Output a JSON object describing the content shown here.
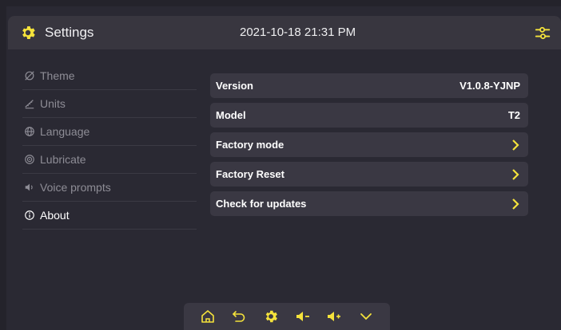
{
  "header": {
    "title": "Settings",
    "datetime": "2021-10-18 21:31 PM",
    "icons": [
      "gear-icon",
      "tune-sliders-icon"
    ]
  },
  "sidebar": {
    "items": [
      {
        "label": "Theme",
        "icon": "theme-slash-icon",
        "active": false
      },
      {
        "label": "Units",
        "icon": "ruler-icon",
        "active": false
      },
      {
        "label": "Language",
        "icon": "globe-icon",
        "active": false
      },
      {
        "label": "Lubricate",
        "icon": "lubricate-icon",
        "active": false
      },
      {
        "label": "Voice prompts",
        "icon": "speaker-icon",
        "active": false
      },
      {
        "label": "About",
        "icon": "info-icon",
        "active": true
      }
    ]
  },
  "about": {
    "rows": [
      {
        "label": "Version",
        "value": "V1.0.8-YJNP"
      },
      {
        "label": "Model",
        "value": "T2"
      },
      {
        "label": "Factory mode",
        "value": ""
      },
      {
        "label": "Factory Reset",
        "value": ""
      },
      {
        "label": "Check for updates",
        "value": ""
      }
    ]
  },
  "dock": {
    "icons": [
      "home-icon",
      "back-icon",
      "gear-icon",
      "volume-down-icon",
      "volume-up-icon",
      "chevron-down-icon"
    ]
  },
  "colors": {
    "accent": "#f5e33b",
    "background": "#2a2933",
    "panel": "#3a3843",
    "header": "#38363f"
  }
}
